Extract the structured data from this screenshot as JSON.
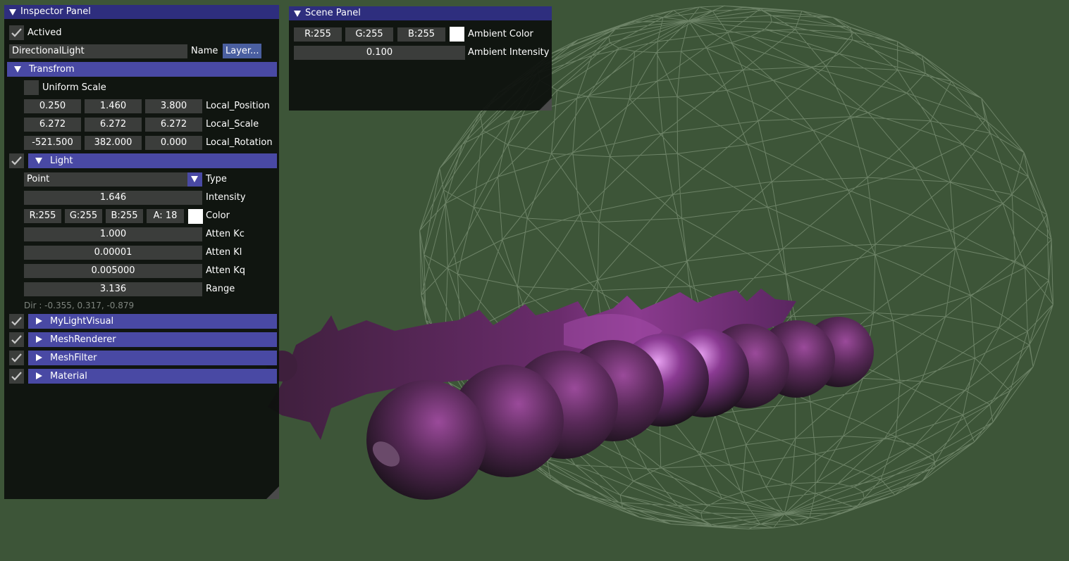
{
  "inspector": {
    "title": "Inspector Panel",
    "actived_label": "Actived",
    "actived": true,
    "name_value": "DirectionalLight",
    "name_label": "Name",
    "layer_button": "Layer...",
    "transform": {
      "header": "Transfrom",
      "uniform_scale_label": "Uniform Scale",
      "uniform_scale": false,
      "rows": [
        {
          "values": [
            "0.250",
            "1.460",
            "3.800"
          ],
          "label": "Local_Position"
        },
        {
          "values": [
            "6.272",
            "6.272",
            "6.272"
          ],
          "label": "Local_Scale"
        },
        {
          "values": [
            "-521.500",
            "382.000",
            "0.000"
          ],
          "label": "Local_Rotation"
        }
      ]
    },
    "light": {
      "header": "Light",
      "enabled": true,
      "type_value": "Point",
      "type_label": "Type",
      "intensity_value": "1.646",
      "intensity_label": "Intensity",
      "color": {
        "r": "R:255",
        "g": "G:255",
        "b": "B:255",
        "a": "A: 18",
        "label": "Color",
        "swatch": "#ffffff"
      },
      "atten_kc_value": "1.000",
      "atten_kc_label": "Atten Kc",
      "atten_kl_value": "0.00001",
      "atten_kl_label": "Atten Kl",
      "atten_kq_value": "0.005000",
      "atten_kq_label": "Atten Kq",
      "range_value": "3.136",
      "range_label": "Range",
      "dir_text": "Dir : -0.355, 0.317, -0.879"
    },
    "components": [
      {
        "label": "MyLightVisual",
        "enabled": true
      },
      {
        "label": "MeshRenderer",
        "enabled": true
      },
      {
        "label": "MeshFilter",
        "enabled": true
      },
      {
        "label": "Material",
        "enabled": true
      }
    ]
  },
  "scene": {
    "title": "Scene Panel",
    "ambient_color": {
      "r": "R:255",
      "g": "G:255",
      "b": "B:255",
      "label": "Ambient Color",
      "swatch": "#ffffff"
    },
    "ambient_intensity_value": "0.100",
    "ambient_intensity_label": "Ambient Intensity"
  },
  "colors": {
    "viewport_bg": "#3d5538",
    "title_bar": "#2e2e7e",
    "section_header": "#4949a4",
    "field_bg": "#3b3d3b",
    "mesh_purple": "#6a2e6a"
  }
}
